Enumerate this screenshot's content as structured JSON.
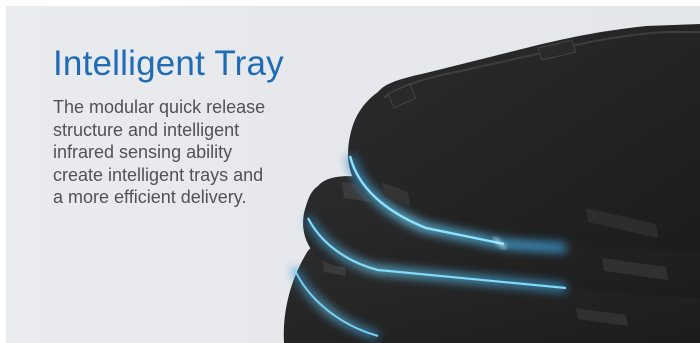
{
  "title": "Intelligent Tray",
  "description_lines": [
    "The modular quick release",
    "structure and intelligent",
    "infrared sensing ability",
    "create intelligent trays and",
    "a more efficient delivery."
  ],
  "colors": {
    "title": "#1f6cb4",
    "body_text": "#4e5358",
    "background": "#e7e9ed",
    "tray": "#232323",
    "tray_glow": "#55c8ff"
  }
}
